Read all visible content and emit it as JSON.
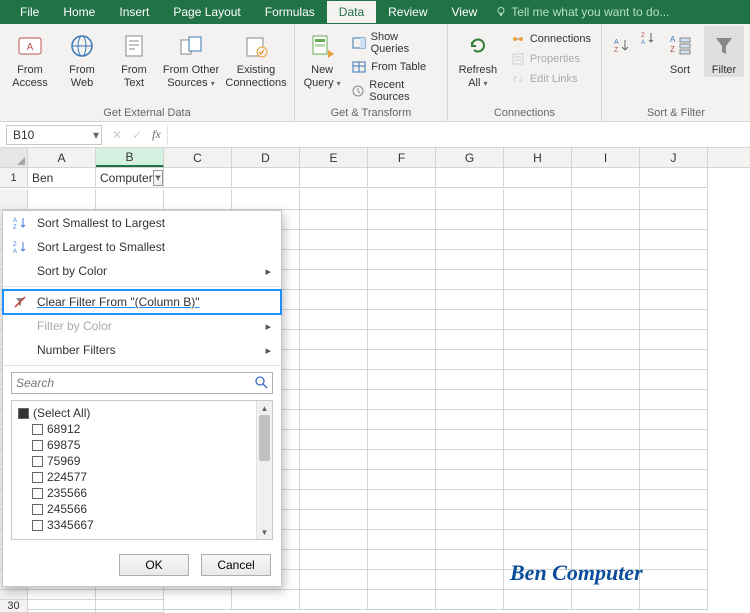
{
  "tabs": {
    "file": "File",
    "home": "Home",
    "insert": "Insert",
    "page_layout": "Page Layout",
    "formulas": "Formulas",
    "data": "Data",
    "review": "Review",
    "view": "View",
    "tell_me": "Tell me what you want to do..."
  },
  "ribbon": {
    "get_external": {
      "label": "Get External Data",
      "from_access": "From\nAccess",
      "from_web": "From\nWeb",
      "from_text": "From\nText",
      "from_other": "From Other\nSources",
      "existing": "Existing\nConnections"
    },
    "get_transform": {
      "label": "Get & Transform",
      "new_query": "New\nQuery",
      "show_queries": "Show Queries",
      "from_table": "From Table",
      "recent_sources": "Recent Sources"
    },
    "connections": {
      "label": "Connections",
      "refresh_all": "Refresh\nAll",
      "connections": "Connections",
      "properties": "Properties",
      "edit_links": "Edit Links"
    },
    "sort_filter": {
      "label": "Sort & Filter",
      "sort": "Sort",
      "filter": "Filter"
    }
  },
  "namebox": "B10",
  "columns": [
    "A",
    "B",
    "C",
    "D",
    "E",
    "F",
    "G",
    "H",
    "I",
    "J"
  ],
  "row1": {
    "num": "1",
    "a_value": "Ben",
    "b_value": "Computer"
  },
  "bottom_row_num": "30",
  "affilter": {
    "sort_az": "Sort Smallest to Largest",
    "sort_za": "Sort Largest to Smallest",
    "sort_color": "Sort by Color",
    "clear": "Clear Filter From \"(Column B)\"",
    "filter_color": "Filter by Color",
    "number_filters": "Number Filters",
    "search_ph": "Search",
    "items": [
      "(Select All)",
      "68912",
      "69875",
      "75969",
      "224577",
      "235566",
      "245566",
      "3345667"
    ],
    "ok": "OK",
    "cancel": "Cancel"
  },
  "watermark": "Ben Computer"
}
